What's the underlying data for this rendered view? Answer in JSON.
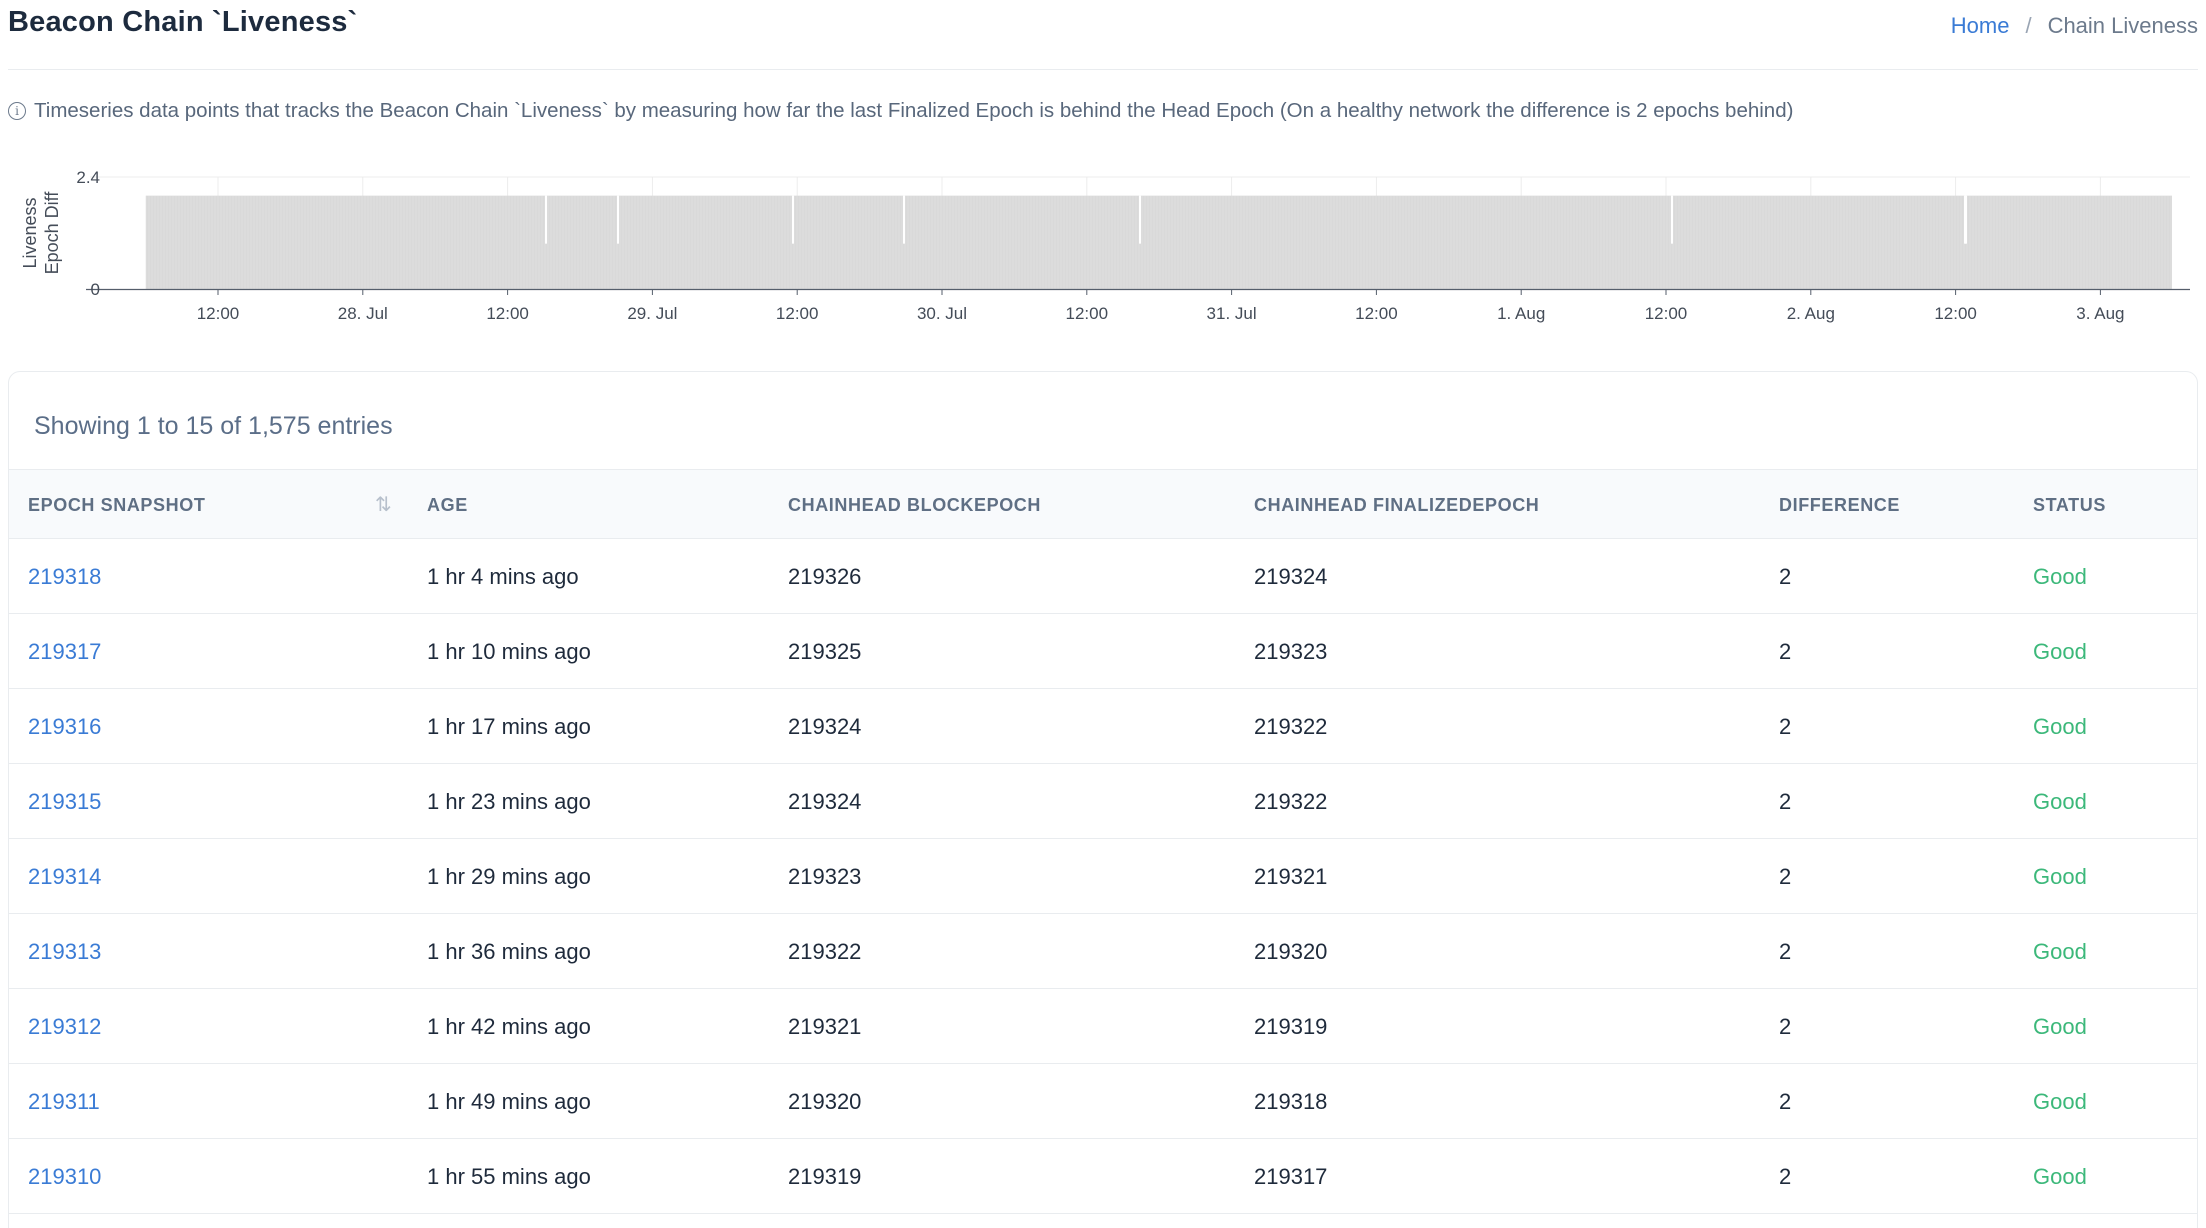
{
  "header": {
    "title": "Beacon Chain `Liveness`",
    "breadcrumb": {
      "home": "Home",
      "separator": "/",
      "current": "Chain Liveness"
    }
  },
  "info": {
    "icon": "info-circle-icon",
    "text": "Timeseries data points that tracks the Beacon Chain `Liveness` by measuring how far the last Finalized Epoch is behind the Head Epoch (On a healthy network the difference is 2 epochs behind)"
  },
  "chart_data": {
    "type": "bar",
    "title": "",
    "xlabel": "",
    "ylabel": "Liveness Epoch Diff",
    "ylim": [
      0,
      2.4
    ],
    "yticks": [
      "0",
      "2.4"
    ],
    "xticks": [
      "12:00",
      "28. Jul",
      "12:00",
      "29. Jul",
      "12:00",
      "30. Jul",
      "12:00",
      "31. Jul",
      "12:00",
      "1. Aug",
      "12:00",
      "2. Aug",
      "12:00",
      "3. Aug"
    ],
    "x_range": [
      "27. Jul 07:00",
      "3. Aug 09:00"
    ],
    "series": [
      {
        "value": 2,
        "gaps_at": [
          "28. Jul 18:00",
          "29. Jul 01:00",
          "29. Jul 13:00",
          "30. Jul 00:00",
          "31. Jul 09:00",
          "2. Aug 01:00",
          "2. Aug 16:00",
          "2. Aug 17:00"
        ]
      }
    ],
    "bar_color": "#d9d9d9",
    "grid": true
  },
  "table": {
    "summary": "Showing 1 to 15 of 1,575 entries",
    "columns": [
      "EPOCH SNAPSHOT",
      "AGE",
      "CHAINHEAD BLOCKEPOCH",
      "CHAINHEAD FINALIZEDEPOCH",
      "DIFFERENCE",
      "STATUS"
    ],
    "rows": [
      [
        "219318",
        "1 hr 4 mins ago",
        "219326",
        "219324",
        "2",
        "Good"
      ],
      [
        "219317",
        "1 hr 10 mins ago",
        "219325",
        "219323",
        "2",
        "Good"
      ],
      [
        "219316",
        "1 hr 17 mins ago",
        "219324",
        "219322",
        "2",
        "Good"
      ],
      [
        "219315",
        "1 hr 23 mins ago",
        "219324",
        "219322",
        "2",
        "Good"
      ],
      [
        "219314",
        "1 hr 29 mins ago",
        "219323",
        "219321",
        "2",
        "Good"
      ],
      [
        "219313",
        "1 hr 36 mins ago",
        "219322",
        "219320",
        "2",
        "Good"
      ],
      [
        "219312",
        "1 hr 42 mins ago",
        "219321",
        "219319",
        "2",
        "Good"
      ],
      [
        "219311",
        "1 hr 49 mins ago",
        "219320",
        "219318",
        "2",
        "Good"
      ],
      [
        "219310",
        "1 hr 55 mins ago",
        "219319",
        "219317",
        "2",
        "Good"
      ]
    ]
  },
  "colors": {
    "link": "#3a7bd5",
    "good": "#3cb87a",
    "bar": "#d9d9d9"
  }
}
